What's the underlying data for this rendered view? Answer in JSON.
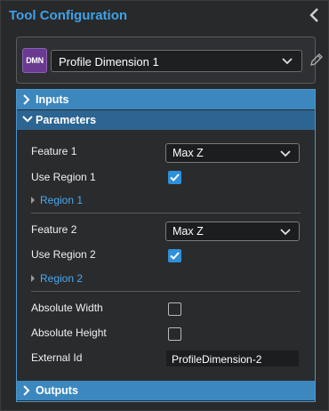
{
  "header": {
    "title": "Tool Configuration",
    "collapse_icon": "chevron-left-icon"
  },
  "tool": {
    "badge": "DMN",
    "selected": "Profile Dimension 1",
    "edit_icon": "pencil-icon"
  },
  "sections": {
    "inputs": "Inputs",
    "parameters": "Parameters",
    "outputs": "Outputs"
  },
  "params": {
    "feature1_label": "Feature 1",
    "feature1_value": "Max Z",
    "use_region1_label": "Use Region 1",
    "use_region1_checked": true,
    "region1_label": "Region 1",
    "feature2_label": "Feature 2",
    "feature2_value": "Max Z",
    "use_region2_label": "Use Region 2",
    "use_region2_checked": true,
    "region2_label": "Region 2",
    "abs_width_label": "Absolute Width",
    "abs_width_checked": false,
    "abs_height_label": "Absolute Height",
    "abs_height_checked": false,
    "external_id_label": "External Id",
    "external_id_value": "ProfileDimension-2"
  },
  "colors": {
    "accent": "#3ea2e8",
    "section_bar": "#3d87bf",
    "checkbox_checked": "#2f8fd8"
  }
}
